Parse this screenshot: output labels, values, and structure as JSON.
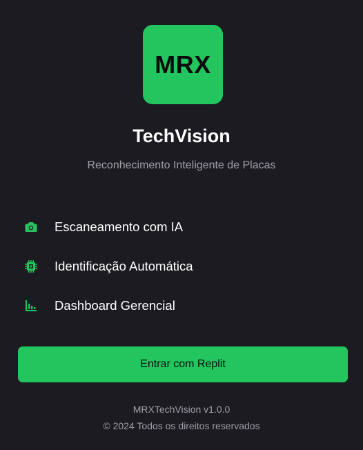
{
  "logo": {
    "text": "MRX",
    "color": "#22c55e"
  },
  "app": {
    "title": "TechVision",
    "subtitle": "Reconhecimento Inteligente de Placas"
  },
  "features": [
    {
      "icon": "camera-icon",
      "label": "Escaneamento com IA"
    },
    {
      "icon": "chip-icon",
      "label": "Identificação Automática"
    },
    {
      "icon": "bar-chart-icon",
      "label": "Dashboard Gerencial"
    }
  ],
  "login": {
    "label": "Entrar com Replit"
  },
  "footer": {
    "version": "MRXTechVision v1.0.0",
    "copyright": "© 2024 Todos os direitos reservados"
  },
  "colors": {
    "background": "#1c1b21",
    "accent": "#22c55e",
    "muted_text": "#a0a0a8"
  }
}
